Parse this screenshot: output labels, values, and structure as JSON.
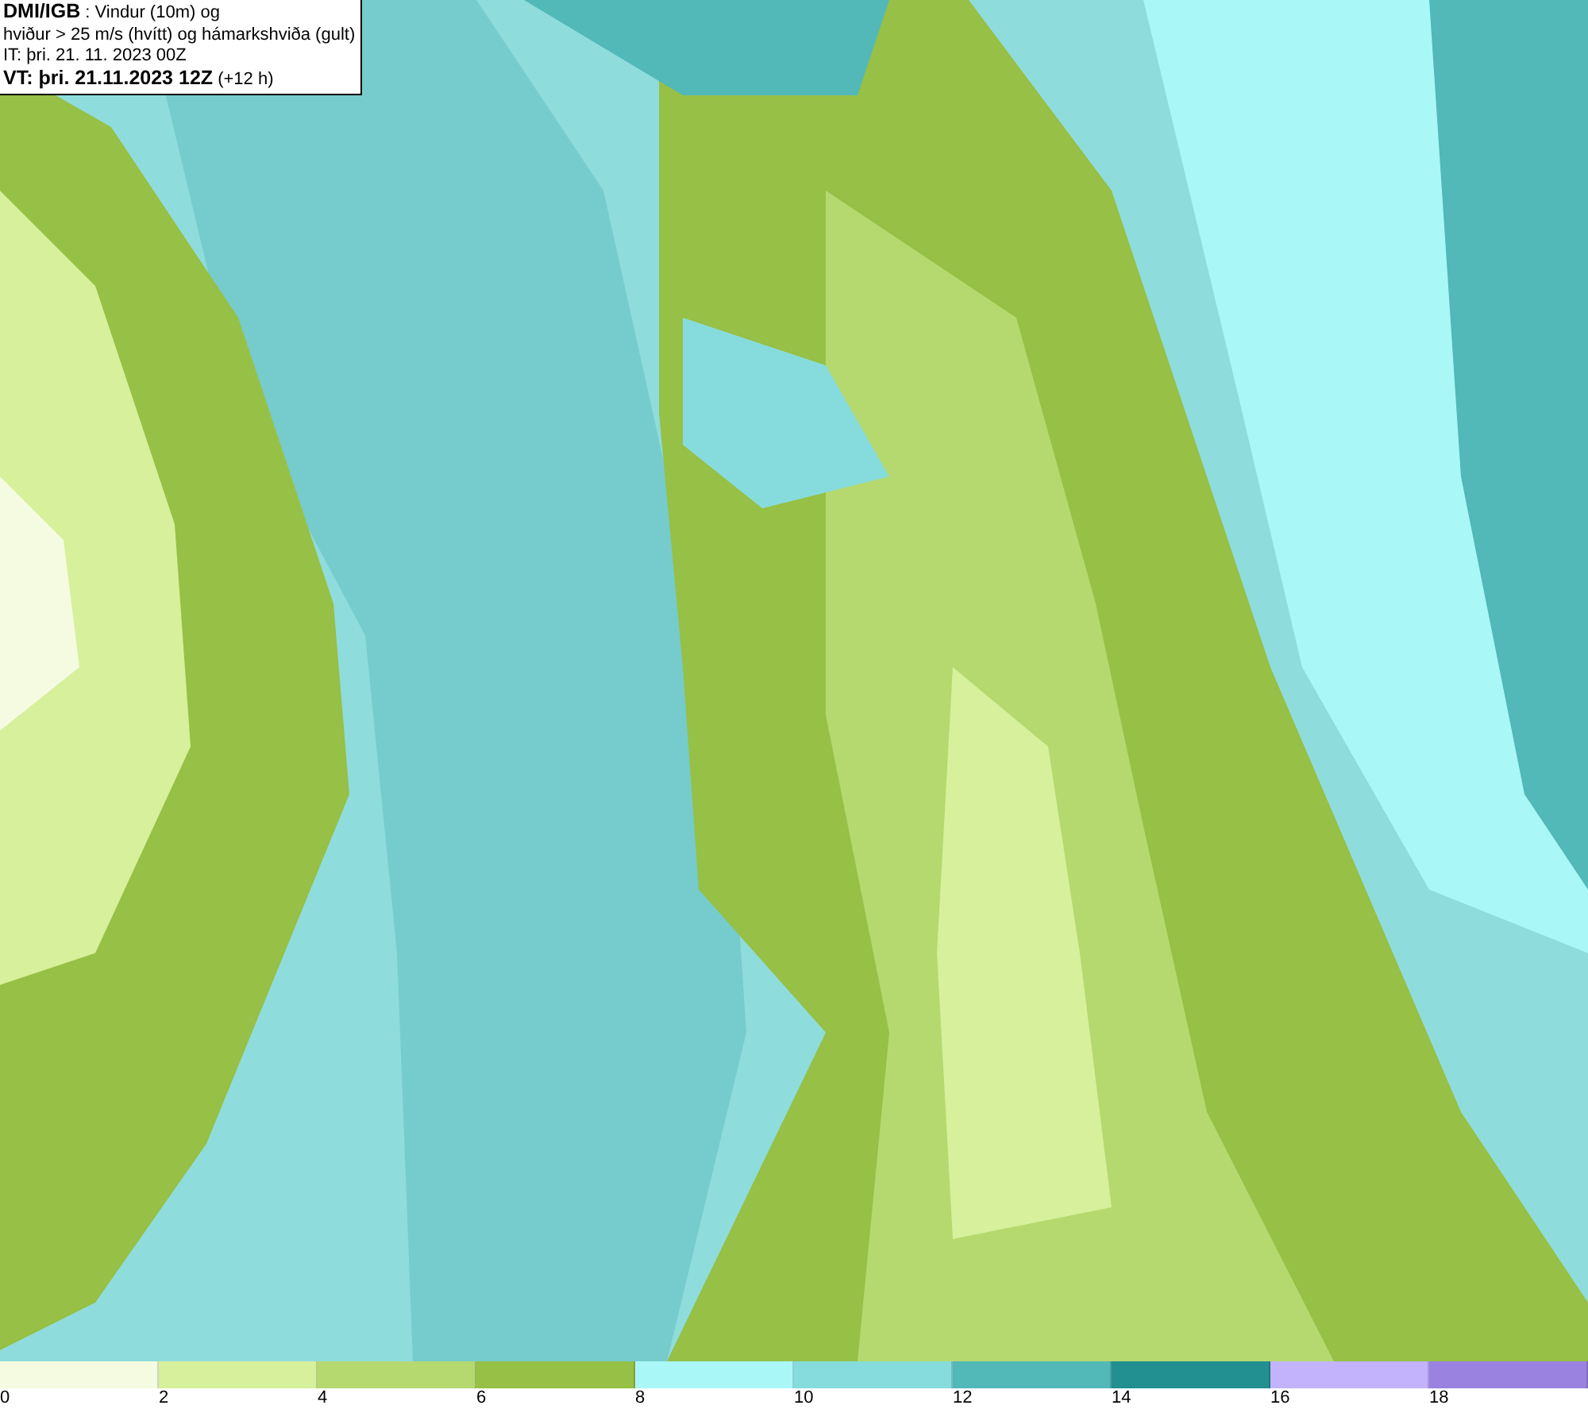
{
  "title_box": {
    "lines": [
      {
        "bold": "DMI/IGB",
        "text": " : Vindur (10m) og"
      },
      {
        "text": "hviður > 25 m/s (hvítt) og hámarkshviða (gult)"
      },
      {
        "text": "IT: þri. 21. 11. 2023 00Z"
      },
      {
        "bold": "VT: þri. 21.11.2023 12Z",
        "text": " (+12 h)"
      }
    ]
  },
  "legend": {
    "bins": [
      {
        "color": "#f5fbe0"
      },
      {
        "color": "#d6f09c"
      },
      {
        "color": "#b5d96e"
      },
      {
        "color": "#96c046"
      },
      {
        "color": "#aaf7f8"
      },
      {
        "color": "#86dcdc"
      },
      {
        "color": "#52b8b8"
      },
      {
        "color": "#229090"
      },
      {
        "color": "#c3b3fc"
      },
      {
        "color": "#9a82e0"
      }
    ],
    "ticks": [
      "0",
      "2",
      "4",
      "6",
      "8",
      "10",
      "12",
      "14",
      "16",
      "18"
    ]
  }
}
